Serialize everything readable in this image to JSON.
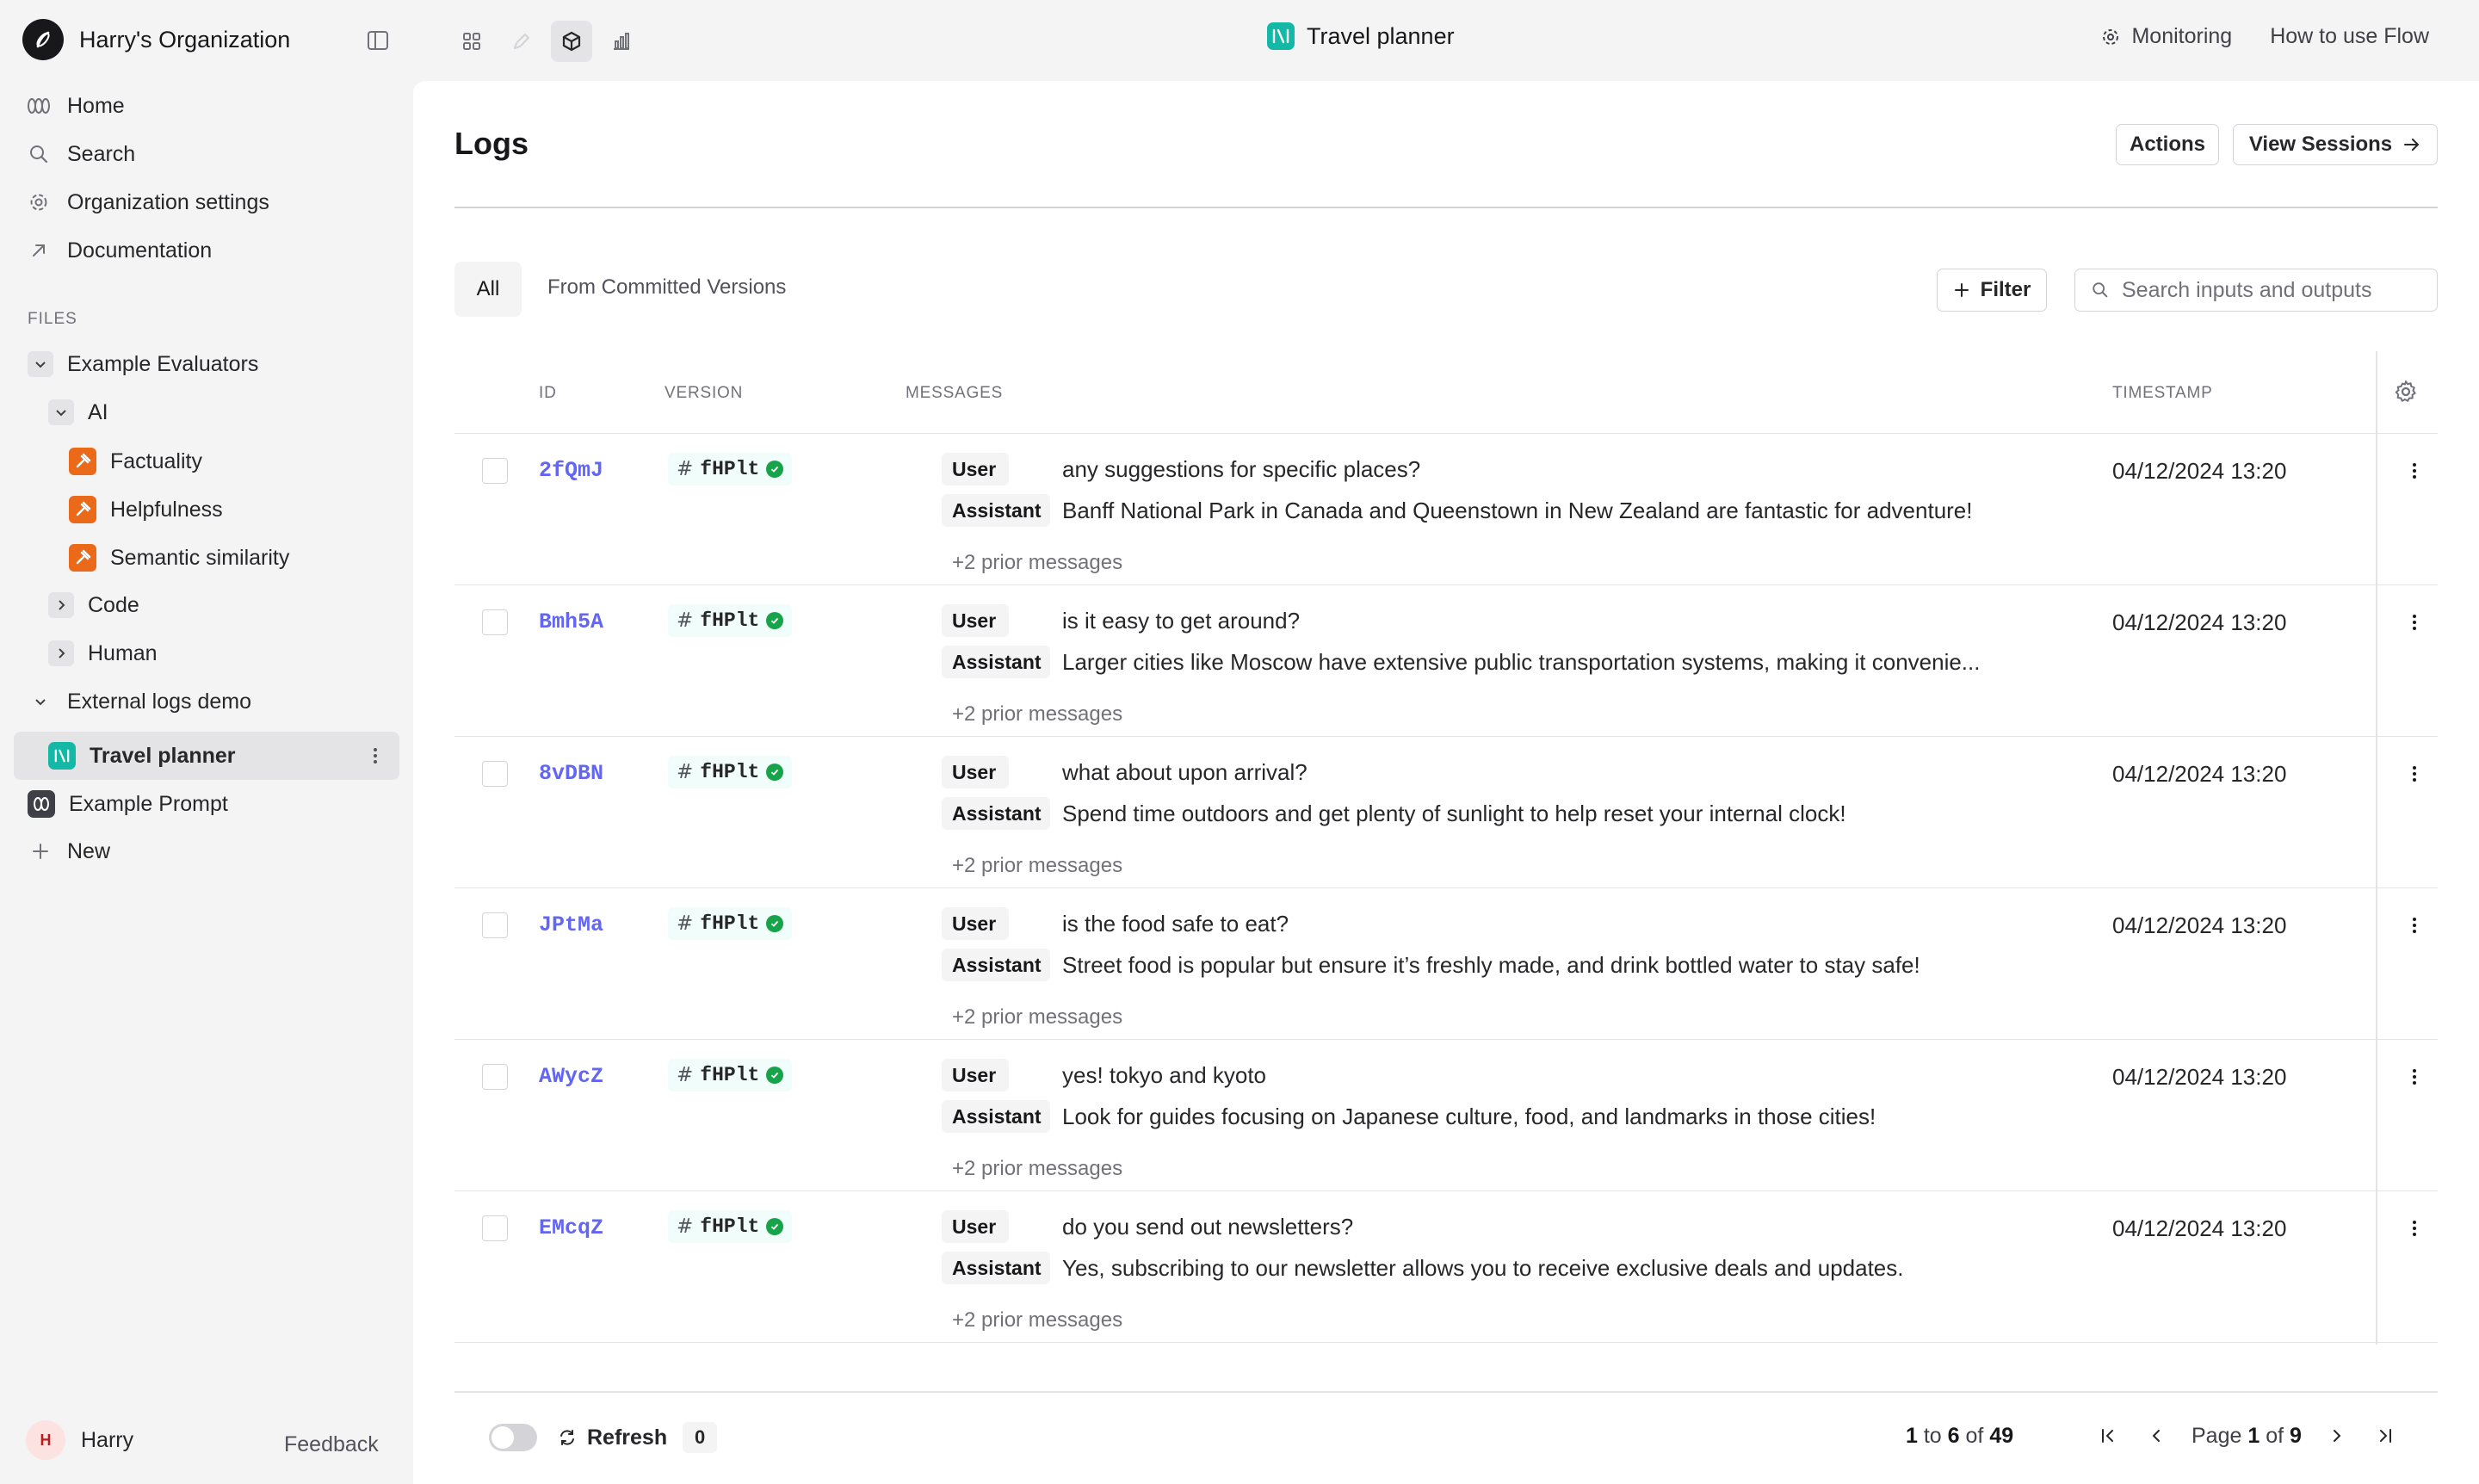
{
  "org": {
    "name": "Harry's Organization"
  },
  "header": {
    "title": "Travel planner",
    "links": {
      "monitoring": "Monitoring",
      "how_to": "How to use Flow"
    }
  },
  "sidebar": {
    "nav": [
      {
        "label": "Home",
        "icon": "home-icon"
      },
      {
        "label": "Search",
        "icon": "search-icon"
      },
      {
        "label": "Organization settings",
        "icon": "gear-icon"
      },
      {
        "label": "Documentation",
        "icon": "arrow-up-right-icon"
      }
    ],
    "files_label": "FILES",
    "tree": {
      "example_evaluators": "Example Evaluators",
      "ai": "AI",
      "factuality": "Factuality",
      "helpfulness": "Helpfulness",
      "semantic_similarity": "Semantic similarity",
      "code": "Code",
      "human": "Human",
      "external_logs_demo": "External logs demo",
      "travel_planner": "Travel planner",
      "example_prompt": "Example Prompt",
      "new": "New"
    },
    "user": {
      "initial": "H",
      "name": "Harry"
    },
    "feedback": "Feedback"
  },
  "main": {
    "title": "Logs",
    "actions_label": "Actions",
    "view_sessions_label": "View Sessions",
    "tabs": {
      "all": "All",
      "committed": "From Committed Versions"
    },
    "filter_label": "Filter",
    "search_placeholder": "Search inputs and outputs",
    "columns": {
      "id": "ID",
      "version": "VERSION",
      "messages": "MESSAGES",
      "timestamp": "TIMESTAMP"
    },
    "user_role": "User",
    "assistant_role": "Assistant",
    "rows": [
      {
        "id": "2fQmJ",
        "version": "fHPlt",
        "user": "any suggestions for specific places?",
        "assistant": "Banff National Park in Canada and Queenstown in New Zealand are fantastic for adventure!",
        "prior": "+2 prior messages",
        "timestamp": "04/12/2024 13:20"
      },
      {
        "id": "Bmh5A",
        "version": "fHPlt",
        "user": "is it easy to get around?",
        "assistant": "Larger cities like Moscow have extensive public transportation systems, making it convenie...",
        "prior": "+2 prior messages",
        "timestamp": "04/12/2024 13:20"
      },
      {
        "id": "8vDBN",
        "version": "fHPlt",
        "user": "what about upon arrival?",
        "assistant": "Spend time outdoors and get plenty of sunlight to help reset your internal clock!",
        "prior": "+2 prior messages",
        "timestamp": "04/12/2024 13:20"
      },
      {
        "id": "JPtMa",
        "version": "fHPlt",
        "user": "is the food safe to eat?",
        "assistant": "Street food is popular but ensure it’s freshly made, and drink bottled water to stay safe!",
        "prior": "+2 prior messages",
        "timestamp": "04/12/2024 13:20"
      },
      {
        "id": "AWycZ",
        "version": "fHPlt",
        "user": "yes! tokyo and kyoto",
        "assistant": "Look for guides focusing on Japanese culture, food, and landmarks in those cities!",
        "prior": "+2 prior messages",
        "timestamp": "04/12/2024 13:20"
      },
      {
        "id": "EMcqZ",
        "version": "fHPlt",
        "user": "do you send out newsletters?",
        "assistant": "Yes, subscribing to our newsletter allows you to receive exclusive deals and updates.",
        "prior": "+2 prior messages",
        "timestamp": "04/12/2024 13:20"
      }
    ],
    "footer": {
      "refresh_label": "Refresh",
      "refresh_count": "0",
      "range_from": "1",
      "range_to": "6",
      "range_total": "49",
      "range_to_word": "to",
      "range_of_word": "of",
      "page_word": "Page",
      "page_current": "1",
      "page_of_word": "of",
      "page_total": "9"
    }
  },
  "colors": {
    "accent_id": "#6366f1",
    "evaluator_orange": "#ea6a1a",
    "travel_teal": "#14b8a6",
    "ok_green": "#16a34a"
  }
}
